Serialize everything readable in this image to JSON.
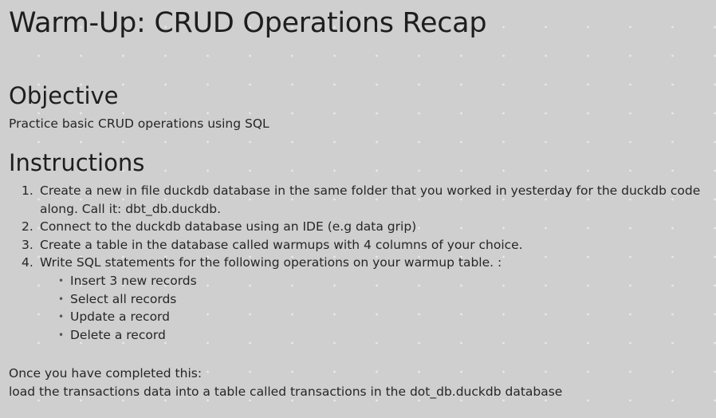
{
  "title": "Warm-Up: CRUD Operations Recap",
  "objective": {
    "heading": "Objective",
    "text": "Practice basic CRUD operations using SQL"
  },
  "instructions": {
    "heading": "Instructions",
    "steps": [
      "Create a new in file duckdb database in the same folder that you worked in yesterday for the duckdb code along. Call it:  dbt_db.duckdb.",
      "Connect to the duckdb database using an IDE (e.g data grip)",
      "Create a table in the database called warmups with 4 columns of your choice.",
      "Write SQL statements for the following operations on your warmup table. :"
    ],
    "operations": [
      "Insert 3 new records",
      "Select all records",
      "Update a record",
      "Delete a record"
    ]
  },
  "footer": {
    "line1": "Once you have completed this:",
    "line2": "load the transactions data into a table called transactions in the dot_db.duckdb database"
  }
}
